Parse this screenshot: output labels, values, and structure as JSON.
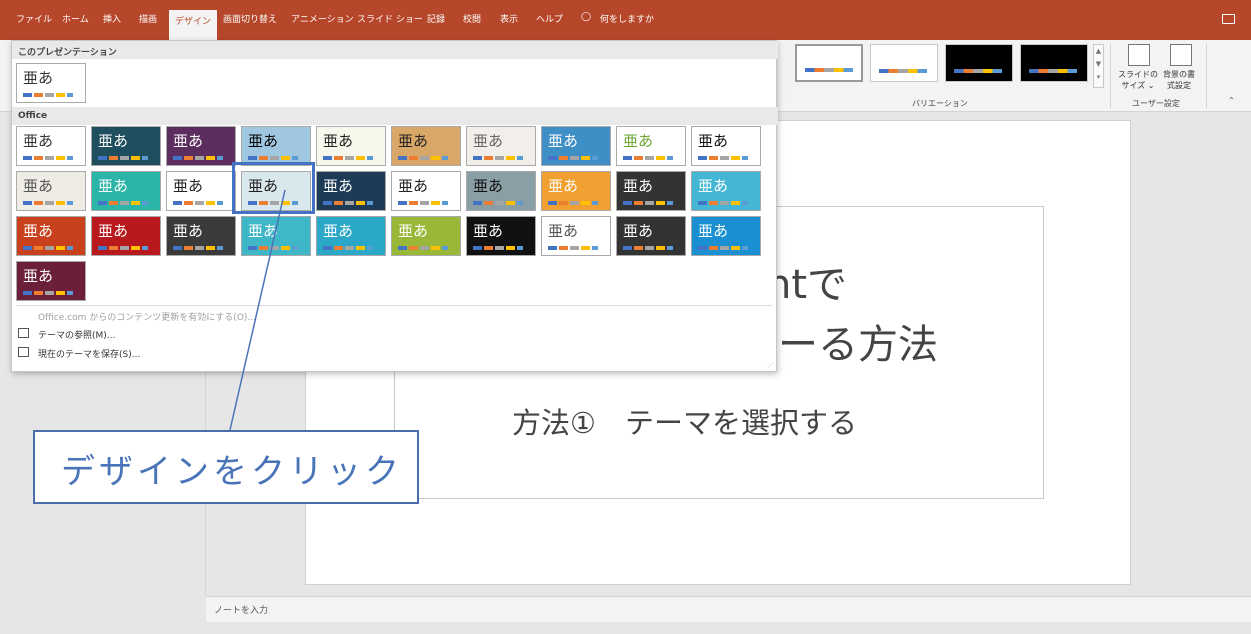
{
  "ribbon": {
    "tabs": [
      {
        "label": "ファイル",
        "active": false
      },
      {
        "label": "ホーム",
        "active": false
      },
      {
        "label": "挿入",
        "active": false
      },
      {
        "label": "描画",
        "active": false
      },
      {
        "label": "デザイン",
        "active": true
      },
      {
        "label": "画面切り替え",
        "active": false
      },
      {
        "label": "アニメーション",
        "active": false
      },
      {
        "label": "スライド ショー",
        "active": false
      },
      {
        "label": "記録",
        "active": false
      },
      {
        "label": "校閲",
        "active": false
      },
      {
        "label": "表示",
        "active": false
      },
      {
        "label": "ヘルプ",
        "active": false
      }
    ],
    "tell_me": "何をしますか",
    "variations_label": "バリエーション",
    "slide_size_label_1": "スライドの",
    "slide_size_label_2": "サイズ",
    "format_bg_label_1": "背景の書",
    "format_bg_label_2": "式設定",
    "user_settings_label": "ユーザー設定"
  },
  "gallery": {
    "this_presentation_header": "このプレゼンテーション",
    "office_header": "Office",
    "tile_text": "亜あ",
    "office_link": "Office.com からのコンテンツ更新を有効にする(O)...",
    "browse_themes": "テーマの参照(M)...",
    "save_theme": "現在のテーマを保存(S)..."
  },
  "slide": {
    "title_line1_fragment": "ntで",
    "title_line2_fragment": "る方法",
    "subtitle": "方法①　テーマを選択する"
  },
  "notes_placeholder": "ノートを入力",
  "annotation": {
    "callout_text": "デザインをクリック"
  },
  "colors": {
    "ribbon_accent": "#b7472a",
    "annotation_blue": "#4472c4"
  }
}
